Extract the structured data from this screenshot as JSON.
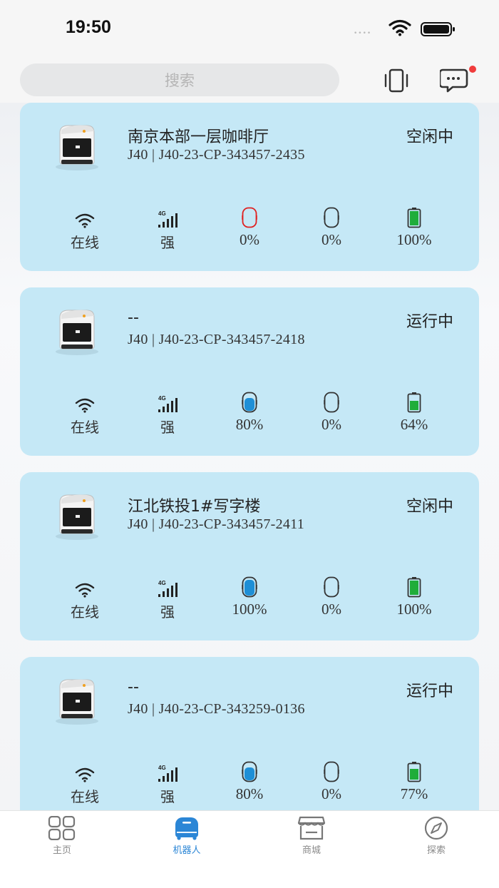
{
  "status_bar": {
    "time": "19:50",
    "dots": "••••"
  },
  "search": {
    "placeholder": "搜索"
  },
  "robots": [
    {
      "name": "南京本部一层咖啡厅",
      "model": "J40 | J40-23-CP-343457-2435",
      "state": "空闲中",
      "wifi_label": "在线",
      "signal_label": "强",
      "tank1_label": "0%",
      "tank1_level": 0,
      "tank1_alert": true,
      "tank2_label": "0%",
      "battery_label": "100%",
      "battery_level": 1.0
    },
    {
      "name": "--",
      "model": "J40 | J40-23-CP-343457-2418",
      "state": "运行中",
      "wifi_label": "在线",
      "signal_label": "强",
      "tank1_label": "80%",
      "tank1_level": 0.8,
      "tank1_alert": false,
      "tank2_label": "0%",
      "battery_label": "64%",
      "battery_level": 0.64
    },
    {
      "name": "江北铁投1#写字楼",
      "model": "J40 | J40-23-CP-343457-2411",
      "state": "空闲中",
      "wifi_label": "在线",
      "signal_label": "强",
      "tank1_label": "100%",
      "tank1_level": 1.0,
      "tank1_alert": false,
      "tank2_label": "0%",
      "battery_label": "100%",
      "battery_level": 1.0
    },
    {
      "name": "--",
      "model": "J40 | J40-23-CP-343259-0136",
      "state": "运行中",
      "wifi_label": "在线",
      "signal_label": "强",
      "tank1_label": "80%",
      "tank1_level": 0.8,
      "tank1_alert": false,
      "tank2_label": "0%",
      "battery_label": "77%",
      "battery_level": 0.77
    }
  ],
  "tabbar": {
    "home": "主页",
    "robots": "机器人",
    "shop": "商城",
    "explore": "探索"
  },
  "colors": {
    "accent": "#2b86d6",
    "card": "#c5e8f6",
    "tank_fill": "#1e8fd6",
    "battery_fill": "#1fad3a",
    "alert": "#e02020",
    "notification_dot": "#f03c3c"
  },
  "icons": {
    "signal_badge": "4G"
  }
}
